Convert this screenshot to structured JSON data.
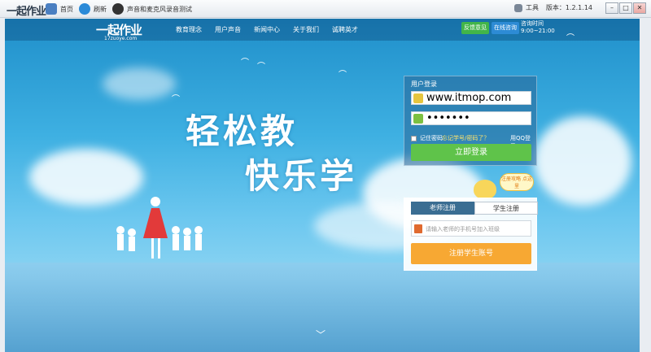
{
  "window": {
    "app_name": "一起作业",
    "toolbar": [
      {
        "label": "首页",
        "icon": "home-icon"
      },
      {
        "label": "刷新",
        "icon": "refresh-icon"
      },
      {
        "label": "声音和麦克风录音测试",
        "icon": "headset-icon"
      }
    ],
    "tools_label": "工具",
    "version": "版本：1.2.1.14",
    "controls": [
      "minimize",
      "maximize",
      "close"
    ]
  },
  "site": {
    "logo": "一起作业",
    "logo_sub": "17zuoye.com",
    "nav": [
      "教育理念",
      "用户声音",
      "新闻中心",
      "关于我们",
      "诚聘英才"
    ],
    "feedback": "反馈意见",
    "consult": "在线咨询",
    "hours_label": "咨询时间",
    "hours": "9:00~21:00"
  },
  "hero": {
    "line1": "轻松教",
    "line2": "快乐学"
  },
  "login": {
    "title": "用户登录",
    "username": "www.itmop.com",
    "password": "•••••••",
    "remember": "记住密码",
    "forgot": "忘记学号/密码了？",
    "qq": "用QQ登录",
    "submit": "立即登录"
  },
  "mascot": {
    "bubble": "注册攻略 点这里"
  },
  "register": {
    "tab_teacher": "老师注册",
    "tab_student": "学生注册",
    "placeholder": "请输入老师的手机号加入班级",
    "submit": "注册学生账号"
  },
  "colors": {
    "login_green": "#5fc34a",
    "register_orange": "#f7a833",
    "sky_blue": "#3eb0e2"
  }
}
